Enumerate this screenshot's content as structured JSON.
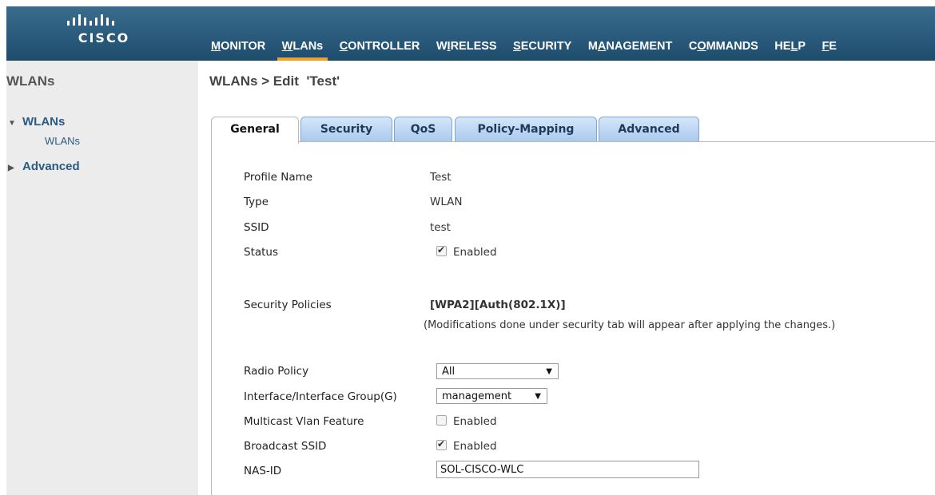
{
  "header": {
    "logo_text": "CISCO",
    "nav": [
      {
        "pre": "",
        "u": "M",
        "post": "ONITOR",
        "active": false
      },
      {
        "pre": "",
        "u": "W",
        "post": "LANs",
        "active": true
      },
      {
        "pre": "",
        "u": "C",
        "post": "ONTROLLER",
        "active": false
      },
      {
        "pre": "W",
        "u": "I",
        "post": "RELESS",
        "active": false
      },
      {
        "pre": "",
        "u": "S",
        "post": "ECURITY",
        "active": false
      },
      {
        "pre": "M",
        "u": "A",
        "post": "NAGEMENT",
        "active": false
      },
      {
        "pre": "C",
        "u": "O",
        "post": "MMANDS",
        "active": false
      },
      {
        "pre": "HE",
        "u": "L",
        "post": "P",
        "active": false
      },
      {
        "pre": "",
        "u": "F",
        "post": "E",
        "active": false
      }
    ],
    "accent_color": "#f0a030"
  },
  "sidebar": {
    "title": "WLANs",
    "wlans_label": "WLANs",
    "wlans_sub": "WLANs",
    "advanced_label": "Advanced"
  },
  "page": {
    "title": "WLANs > Edit  'Test'"
  },
  "tabs": [
    {
      "label": "General",
      "active": true
    },
    {
      "label": "Security",
      "active": false
    },
    {
      "label": "QoS",
      "active": false
    },
    {
      "label": "Policy-Mapping",
      "active": false
    },
    {
      "label": "Advanced",
      "active": false
    }
  ],
  "form": {
    "profile_name_label": "Profile Name",
    "profile_name_value": "Test",
    "type_label": "Type",
    "type_value": "WLAN",
    "ssid_label": "SSID",
    "ssid_value": "test",
    "status_label": "Status",
    "status_checked": true,
    "status_value": "Enabled",
    "security_policies_label": "Security Policies",
    "security_policies_value": "[WPA2][Auth(802.1X)]",
    "security_note": "(Modifications done under security tab will appear after applying the changes.)",
    "radio_policy_label": "Radio Policy",
    "radio_policy_value": "All",
    "interface_label": "Interface/Interface Group(G)",
    "interface_value": "management",
    "multicast_label": "Multicast Vlan Feature",
    "multicast_checked": false,
    "multicast_value": "Enabled",
    "broadcast_label": "Broadcast SSID",
    "broadcast_checked": true,
    "broadcast_value": "Enabled",
    "nas_id_label": "NAS-ID",
    "nas_id_value": "SOL-CISCO-WLC"
  }
}
